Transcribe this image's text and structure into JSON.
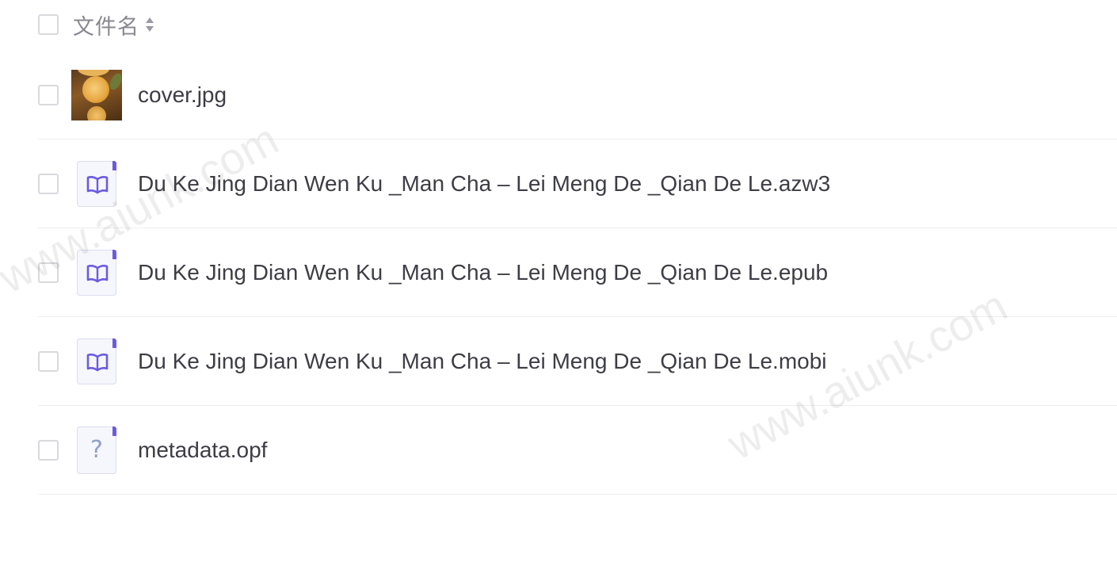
{
  "header": {
    "column_label": "文件名",
    "sort_icon": "sort-icon"
  },
  "files": [
    {
      "name": "cover.jpg",
      "icon": "image-thumbnail"
    },
    {
      "name": "Du Ke Jing Dian Wen Ku _Man Cha – Lei Meng De _Qian De Le.azw3",
      "icon": "book-icon"
    },
    {
      "name": "Du Ke Jing Dian Wen Ku _Man Cha – Lei Meng De _Qian De Le.epub",
      "icon": "book-icon"
    },
    {
      "name": "Du Ke Jing Dian Wen Ku _Man Cha – Lei Meng De _Qian De Le.mobi",
      "icon": "book-icon"
    },
    {
      "name": "metadata.opf",
      "icon": "unknown-file-icon"
    }
  ],
  "watermark": "www.aiunk.com",
  "colors": {
    "accent": "#6a5ce0",
    "text": "#3d3d45",
    "header_text": "#888890",
    "divider": "#eeeef2"
  }
}
